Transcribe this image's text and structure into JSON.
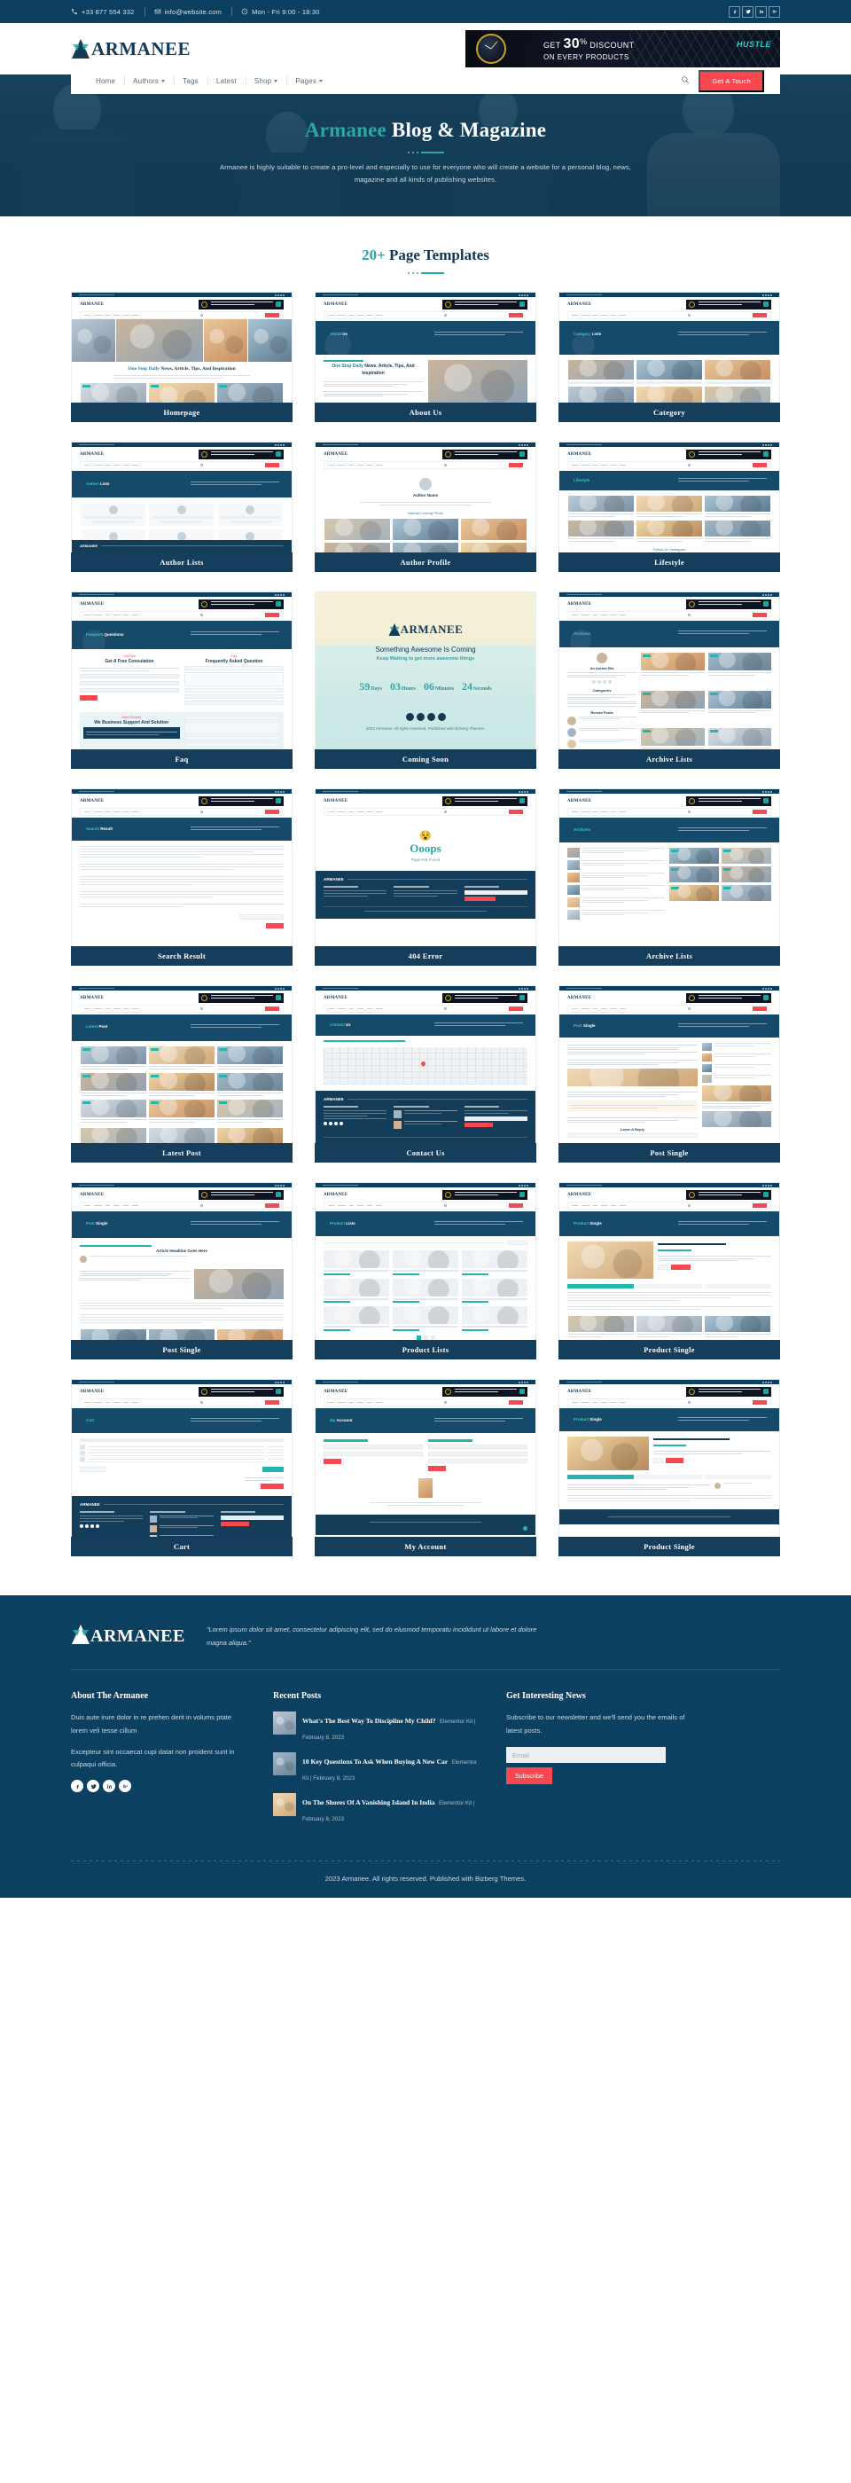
{
  "topbar": {
    "phone": "+33 877 554 332",
    "email": "info@website.com",
    "hours": "Mon - Fri 9:00 - 18:30",
    "socials": [
      "facebook-icon",
      "twitter-icon",
      "linkedin-icon",
      "google-plus-icon"
    ]
  },
  "header": {
    "brand": "ARMANEE",
    "ad": {
      "line1_pre": "GET ",
      "line1_num": "30",
      "line1_pct": "%",
      "line1_post": " DISCOUNT",
      "line2": "ON EVERY PRODUCTS",
      "tag": "HUSTLE"
    }
  },
  "nav": {
    "items": [
      {
        "label": "Home",
        "has_dropdown": false
      },
      {
        "label": "Authors",
        "has_dropdown": true
      },
      {
        "label": "Tags",
        "has_dropdown": false
      },
      {
        "label": "Latest",
        "has_dropdown": false
      },
      {
        "label": "Shop",
        "has_dropdown": true
      },
      {
        "label": "Pages",
        "has_dropdown": true
      }
    ],
    "cta": "Get A Touch"
  },
  "hero": {
    "title_accent": "Armanee",
    "title_rest": " Blog & Magazine",
    "subtitle": "Armanee is highly suitable to create a pro-level and especially to use for everyone who will create a website for a personal blog, news, magazine and all kinds of publishing websites."
  },
  "section": {
    "title_num": "20+",
    "title_text": " Page Templates"
  },
  "templates": [
    {
      "label": "Homepage",
      "kind": "homepage"
    },
    {
      "label": "About Us",
      "kind": "about"
    },
    {
      "label": "Category",
      "kind": "category"
    },
    {
      "label": "Author Lists",
      "kind": "author-lists"
    },
    {
      "label": "Author Profile",
      "kind": "author-profile"
    },
    {
      "label": "Lifestyle",
      "kind": "lifestyle"
    },
    {
      "label": "Faq",
      "kind": "faq"
    },
    {
      "label": "Coming Soon",
      "kind": "coming-soon"
    },
    {
      "label": "Archive Lists",
      "kind": "archive-lists"
    },
    {
      "label": "Search Result",
      "kind": "search-result"
    },
    {
      "label": "404 Error",
      "kind": "error-404"
    },
    {
      "label": "Archive Lists",
      "kind": "archive-lists-2"
    },
    {
      "label": "Latest Post",
      "kind": "latest-post"
    },
    {
      "label": "Contact Us",
      "kind": "contact"
    },
    {
      "label": "Post Single",
      "kind": "post-single"
    },
    {
      "label": "Post Single",
      "kind": "post-single-2"
    },
    {
      "label": "Product Lists",
      "kind": "product-lists"
    },
    {
      "label": "Product Single",
      "kind": "product-single"
    },
    {
      "label": "Cart",
      "kind": "cart"
    },
    {
      "label": "My Account",
      "kind": "my-account"
    },
    {
      "label": "Product Single",
      "kind": "product-single-2"
    }
  ],
  "coming_soon_thumb": {
    "brand": "ARMANEE",
    "heading": "Something Awesome Is Coming",
    "subheading": "Keep Waiting to get more awesome things",
    "countdown": [
      {
        "value": "59",
        "unit": "Days"
      },
      {
        "value": "03",
        "unit": "Hours"
      },
      {
        "value": "06",
        "unit": "Minutes"
      },
      {
        "value": "24",
        "unit": "Seconds"
      }
    ],
    "footer": "2023 Armanee. All rights reserved. Published with Bizberg Themes."
  },
  "homepage_thumb": {
    "title_accent": "One Stop Daily",
    "title_rest": " News, Article, Tips, And Inspiration"
  },
  "footer": {
    "brand": "ARMANEE",
    "quote": "\"Lorem ipsum dolor sit amet, consectetur adipiscing elit, sed do elusmod temporatu incididunt ut labore et dolore magna aliqua.\"",
    "about": {
      "heading": "About The Armanee",
      "p1": "Duis aute irure dolor in re prehen derit in volums ptate lorem veli tesse cillum",
      "p2": "Excepteur sint occaecat cupi datat non proident sunt in culpaqui officia.",
      "socials": [
        "facebook-icon",
        "twitter-icon",
        "linkedin-icon",
        "google-plus-icon"
      ]
    },
    "recent": {
      "heading": "Recent Posts",
      "posts": [
        {
          "title": "What's The Best Way To Discipline My Child?",
          "meta": "Elementor Kit | February 8, 2023"
        },
        {
          "title": "10 Key Questions To Ask When Buying A New Car",
          "meta": "Elementor Kit | February 8, 2023"
        },
        {
          "title": "On The Shores Of A Vanishing Island In India",
          "meta": "Elementor Kit | February 8, 2023"
        }
      ]
    },
    "newsletter": {
      "heading": "Get Interesting News",
      "description": "Subscribe to our newsletter and we'll send you the emails of latest posts.",
      "input_placeholder": "Email",
      "input_value": "",
      "button": "Subscribe"
    },
    "copyright": "2023 Armanee. All rights reserved. Published with Bizberg Themes."
  },
  "colors": {
    "dark_blue": "#0c4060",
    "nav_blue": "#153d5c",
    "teal": "#2aa7a8",
    "red": "#f9474f",
    "hero_blue": "#15405c"
  }
}
